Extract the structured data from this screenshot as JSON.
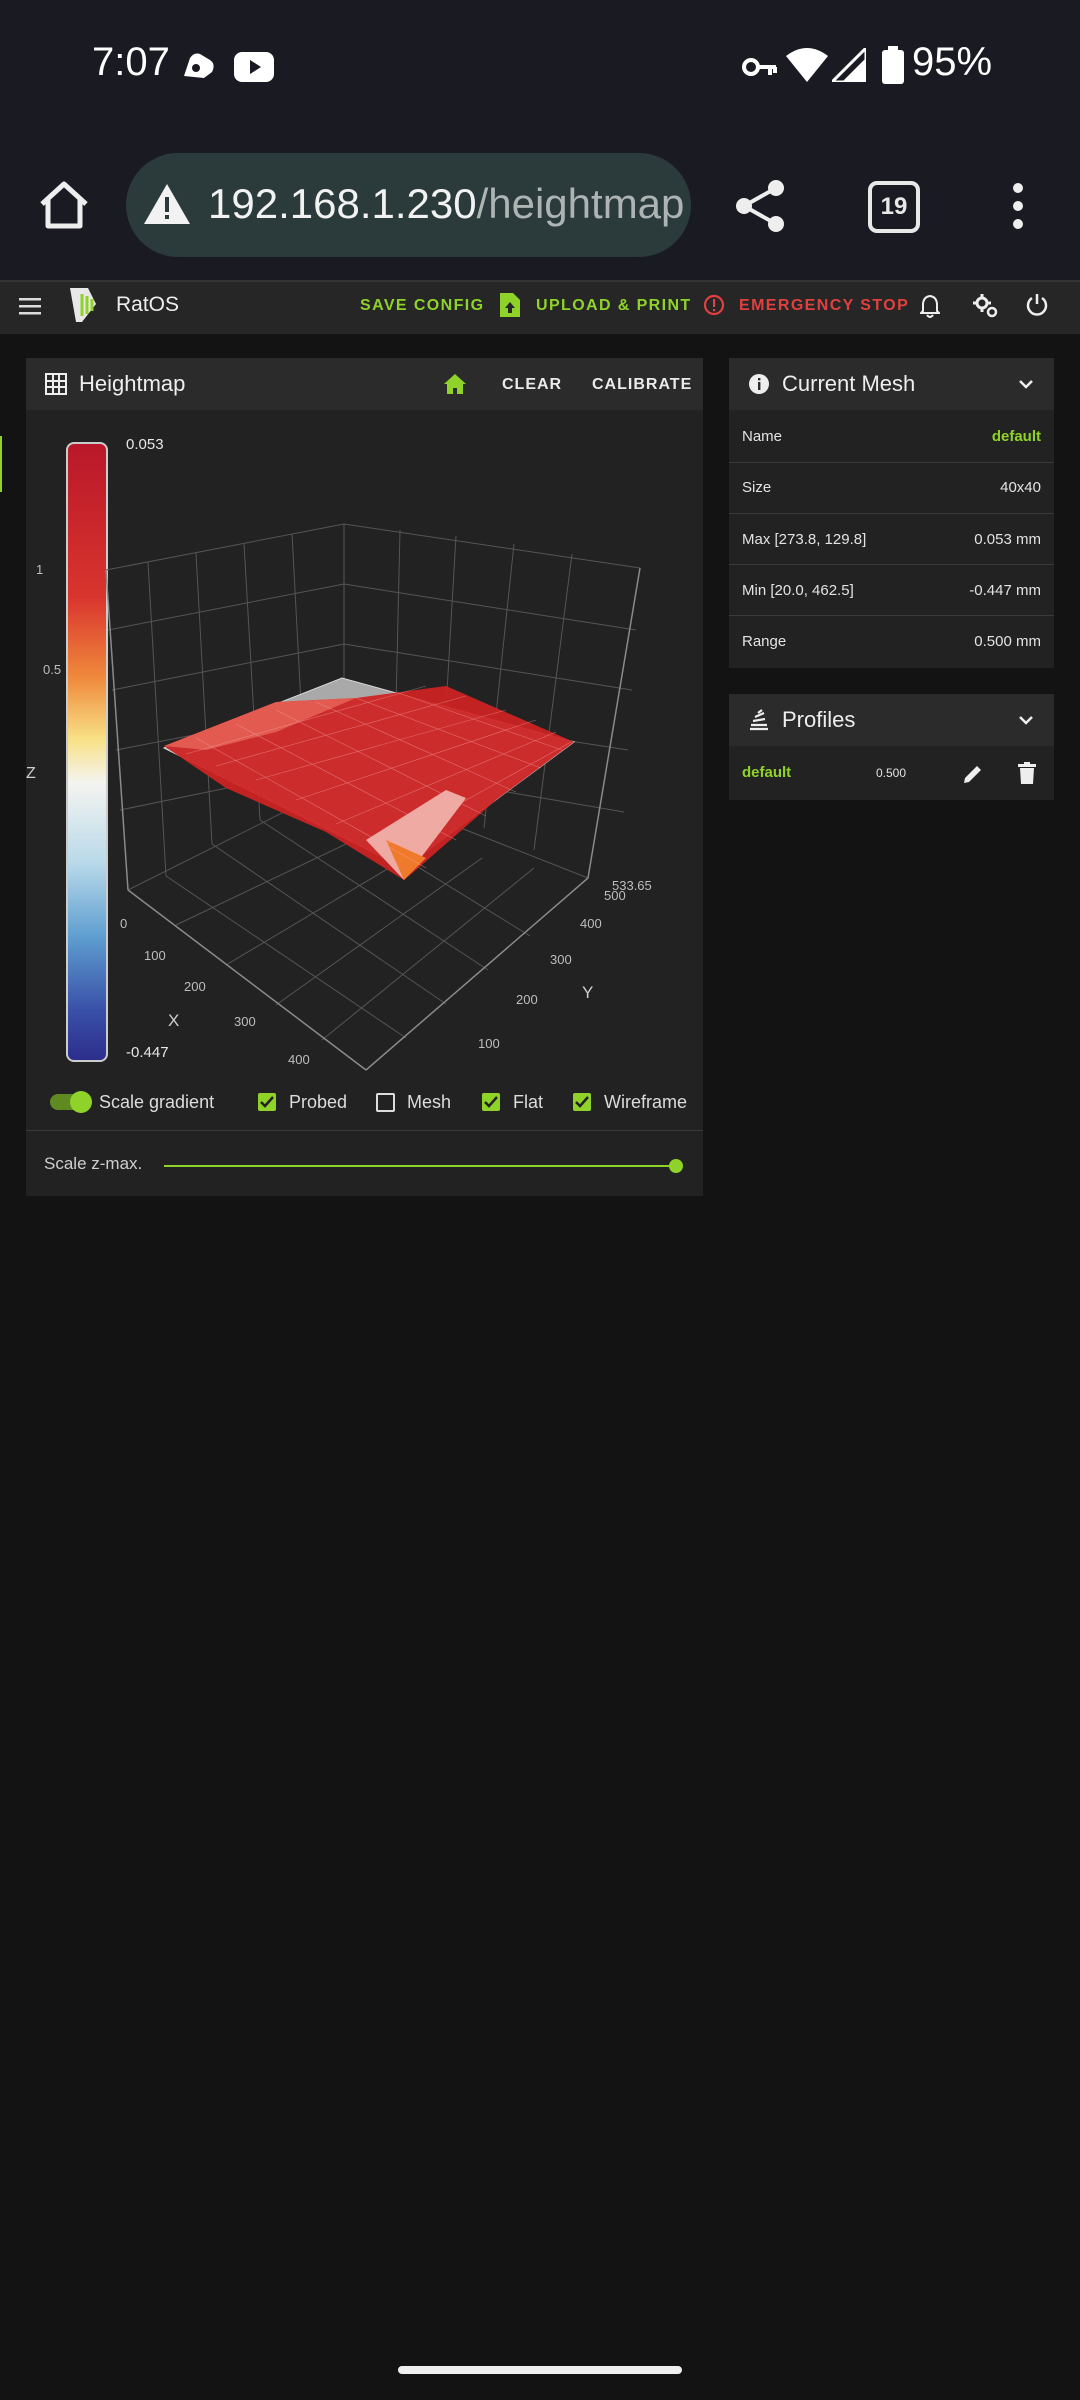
{
  "status_bar": {
    "time": "7:07",
    "battery": "95%"
  },
  "browser": {
    "url_host": "192.168.1.230",
    "url_path": "/heightmap",
    "tab_count": "19"
  },
  "app": {
    "title": "RatOS",
    "save_config": "SAVE CONFIG",
    "upload_print": "UPLOAD & PRINT",
    "emergency_stop": "EMERGENCY STOP"
  },
  "heightmap": {
    "title": "Heightmap",
    "clear": "CLEAR",
    "calibrate": "CALIBRATE",
    "scale_max": "0.053",
    "scale_min": "-0.447",
    "z_label": "Z",
    "x_label": "X",
    "y_label": "Y",
    "z_ticks": [
      "1",
      "0.5"
    ],
    "x_ticks": [
      "0",
      "100",
      "200",
      "300",
      "400"
    ],
    "y_ticks": [
      "100",
      "200",
      "300",
      "400",
      "500",
      "533.65"
    ],
    "options": {
      "scale_gradient": "Scale gradient",
      "probed": "Probed",
      "mesh": "Mesh",
      "flat": "Flat",
      "wireframe": "Wireframe"
    },
    "scale_zmax": "Scale z-max."
  },
  "current_mesh": {
    "title": "Current Mesh",
    "rows": [
      {
        "label": "Name",
        "value": "default"
      },
      {
        "label": "Size",
        "value": "40x40"
      },
      {
        "label": "Max [273.8, 129.8]",
        "value": "0.053 mm"
      },
      {
        "label": "Min [20.0, 462.5]",
        "value": "-0.447 mm"
      },
      {
        "label": "Range",
        "value": "0.500 mm"
      }
    ]
  },
  "profiles": {
    "title": "Profiles",
    "items": [
      {
        "name": "default",
        "range": "0.500"
      }
    ]
  },
  "colors": {
    "accent": "#8fd32a",
    "danger": "#e0403f",
    "surface": "#222222"
  }
}
